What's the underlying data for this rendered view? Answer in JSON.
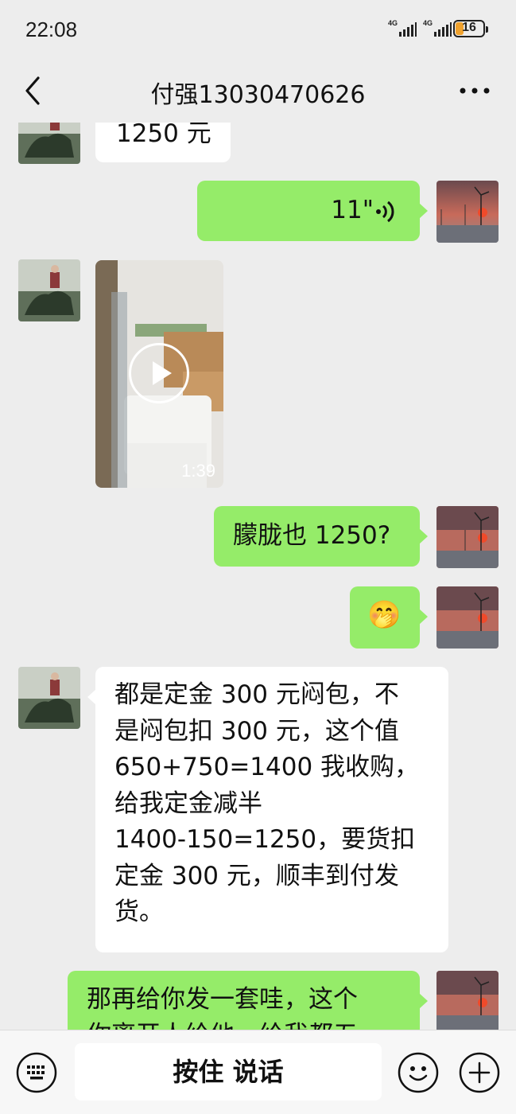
{
  "status_bar": {
    "time": "22:08",
    "network_1": "4G",
    "network_2": "4G",
    "battery_level": "16"
  },
  "header": {
    "title": "付强13030470626",
    "back_icon": "chevron-left-icon",
    "more_icon": "more-horizontal-icon"
  },
  "messages": [
    {
      "side": "left",
      "type": "text",
      "text": "1250 元"
    },
    {
      "side": "right",
      "type": "voice",
      "duration": "11\""
    },
    {
      "side": "left",
      "type": "video",
      "duration": "1:39"
    },
    {
      "side": "right",
      "type": "text",
      "text": "朦胧也 1250?"
    },
    {
      "side": "right",
      "type": "emoji",
      "emoji": "🤭"
    },
    {
      "side": "left",
      "type": "text",
      "lines": [
        "都是定金 300 元闷包，不",
        "是闷包扣 300 元，这个值",
        "650+750=1400 我收购，",
        "给我定金减半",
        "1400-150=1250，要货扣",
        "定金 300 元，顺丰到付发",
        "货。"
      ]
    },
    {
      "side": "right",
      "type": "text",
      "lines": [
        "那再给你发一套哇，这个",
        "你离开人给他一给我都五"
      ]
    }
  ],
  "bottom_bar": {
    "voice_label": "按住 说话",
    "keyboard_icon": "keyboard-icon",
    "emoji_icon": "smiley-icon",
    "plus_icon": "plus-circle-icon"
  },
  "colors": {
    "background": "#ededed",
    "sent_bubble": "#95ec69",
    "received_bubble": "#ffffff"
  }
}
